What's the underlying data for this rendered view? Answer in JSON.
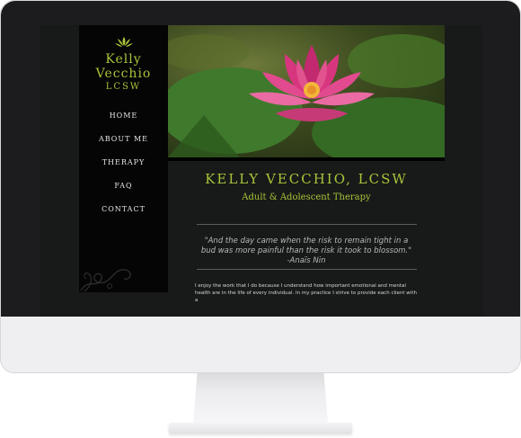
{
  "site": {
    "logo": {
      "line1": "Kelly",
      "line2": "Vecchio",
      "line3": "LCSW"
    },
    "nav": [
      "HOME",
      "ABOUT ME",
      "THERAPY",
      "FAQ",
      "CONTACT"
    ],
    "title": "KELLY VECCHIO, LCSW",
    "subtitle": "Adult & Adolescent Therapy",
    "quote": "\"And the day came when the risk to remain tight in a bud was more painful than the risk it took to blossom.\" -Anaïs Nin",
    "body": "I enjoy the work that I do because I understand how important emotional and mental health are in the life of every individual. In my practice I strive to provide each client with a"
  },
  "colors": {
    "accent": "#a8c43a",
    "sidebar": "#050505",
    "background": "#171a18",
    "lotus": "#d8357f"
  },
  "icons": {
    "logo": "lotus-icon",
    "decoration": "swirl-ornament"
  }
}
